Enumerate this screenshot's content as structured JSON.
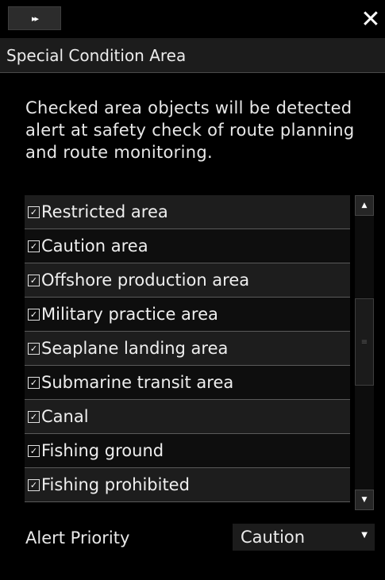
{
  "window": {
    "expand_icon": "fast-forward-icon",
    "expand_glyph": "▸▸",
    "close_glyph": "✕"
  },
  "panel": {
    "title": "Special Condition Area",
    "description": "Checked area objects will be detected alert at safety check of route planning and route monitoring."
  },
  "areas": [
    {
      "label": "Restricted area",
      "checked": true
    },
    {
      "label": "Caution area",
      "checked": true
    },
    {
      "label": "Offshore production area",
      "checked": true
    },
    {
      "label": "Military practice area",
      "checked": true
    },
    {
      "label": "Seaplane landing area",
      "checked": true
    },
    {
      "label": "Submarine transit area",
      "checked": true
    },
    {
      "label": "Canal",
      "checked": true
    },
    {
      "label": "Fishing ground",
      "checked": true
    },
    {
      "label": "Fishing prohibited",
      "checked": true
    }
  ],
  "alert_priority": {
    "label": "Alert Priority",
    "value": "Caution"
  },
  "colors": {
    "background": "#000000",
    "row_odd": "#1d1d1d",
    "row_even": "#0e0e0e",
    "text": "#e6e6e6"
  }
}
